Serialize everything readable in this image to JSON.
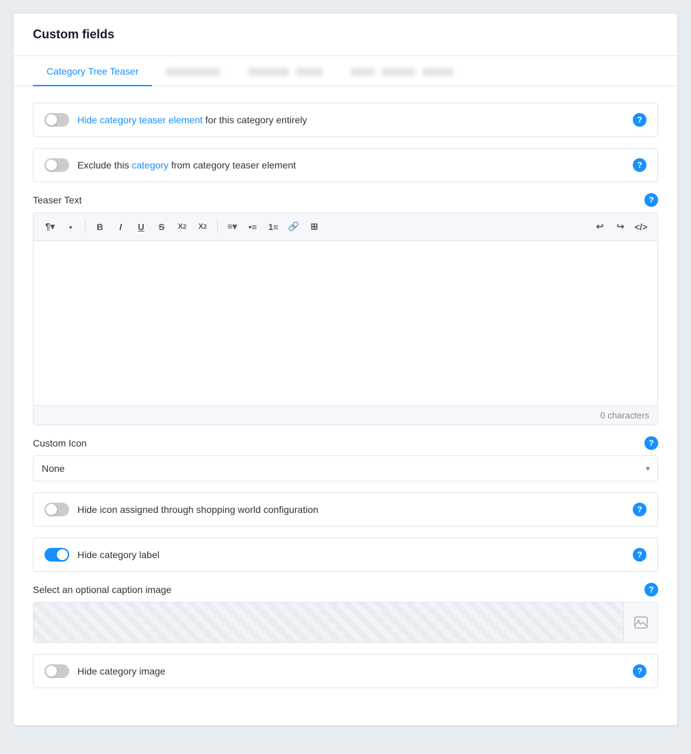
{
  "card": {
    "title": "Custom fields"
  },
  "tabs": [
    {
      "id": "tab1",
      "label": "Category Tree Teaser",
      "active": true
    },
    {
      "id": "tab2",
      "label": "",
      "blurred": true,
      "blurWidths": [
        80
      ]
    },
    {
      "id": "tab3",
      "label": "",
      "blurred": true,
      "blurWidths": [
        60,
        40
      ]
    },
    {
      "id": "tab4",
      "label": "",
      "blurred": true,
      "blurWidths": [
        35,
        50,
        45
      ]
    }
  ],
  "fields": {
    "hide_category_teaser": {
      "label": "Hide category teaser element",
      "label_suffix": " for this category entirely",
      "toggle_on": false
    },
    "exclude_category": {
      "label": "Exclude this category from category teaser element",
      "toggle_on": false
    },
    "teaser_text": {
      "label": "Teaser Text",
      "char_count": "0 characters"
    },
    "custom_icon": {
      "label": "Custom Icon",
      "select_value": "None",
      "select_options": [
        "None"
      ]
    },
    "hide_icon": {
      "label": "Hide icon assigned through shopping world configuration",
      "toggle_on": false
    },
    "hide_category_label": {
      "label": "Hide category label",
      "toggle_on": true
    },
    "caption_image": {
      "label": "Select an optional caption image"
    },
    "hide_category_image": {
      "label": "Hide category image",
      "toggle_on": false
    }
  },
  "toolbar": {
    "buttons": [
      "¶",
      "▪",
      "B",
      "I",
      "U",
      "S",
      "X²",
      "X₂",
      "≡",
      "•≡",
      "1≡",
      "🔗",
      "⊞"
    ]
  },
  "help": "?"
}
